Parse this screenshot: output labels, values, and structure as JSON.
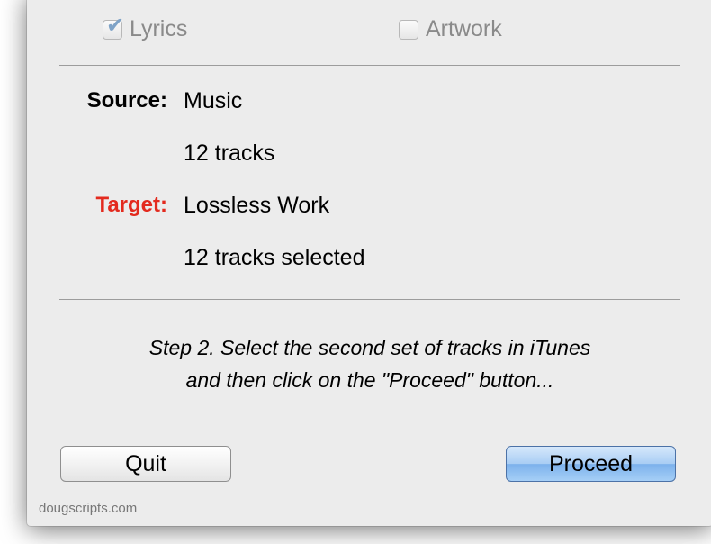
{
  "options": {
    "lyrics": {
      "label": "Lyrics",
      "checked": true
    },
    "artwork": {
      "label": "Artwork",
      "checked": false
    }
  },
  "source": {
    "label": "Source:",
    "name": "Music",
    "count": "12 tracks"
  },
  "target": {
    "label": "Target:",
    "name": "Lossless Work",
    "count": "12 tracks selected",
    "label_color": "#e32a1e"
  },
  "instructions": {
    "line1": "Step 2. Select the second set of tracks in iTunes",
    "line2": "and then click on the \"Proceed\" button..."
  },
  "buttons": {
    "quit": "Quit",
    "proceed": "Proceed"
  },
  "footer": "dougscripts.com",
  "colors": {
    "window_bg": "#ececec",
    "proceed_accent": "#7cb1ec"
  }
}
